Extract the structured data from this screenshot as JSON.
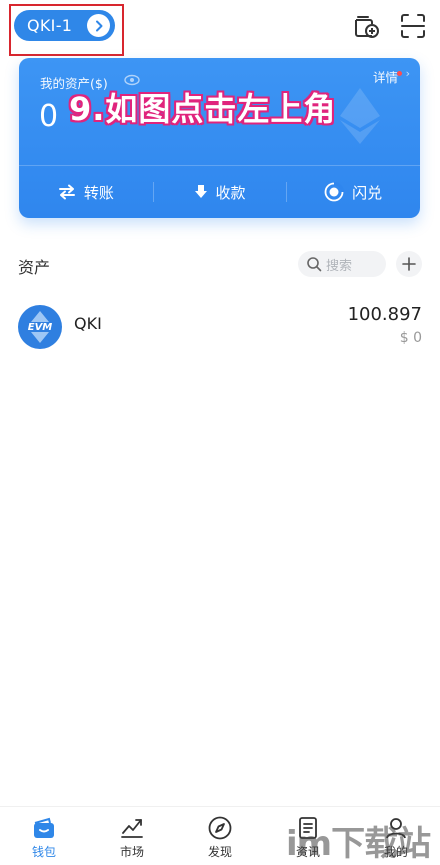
{
  "header": {
    "wallet_name": "QKI-1",
    "icons": [
      "chevron-right-icon",
      "add-wallet-icon",
      "scan-icon"
    ]
  },
  "asset_card": {
    "label": "我的资产($)",
    "amount": "0",
    "detail_label": "详情",
    "actions": [
      {
        "label": "转账",
        "icon": "transfer-icon"
      },
      {
        "label": "收款",
        "icon": "receive-icon"
      },
      {
        "label": "闪兑",
        "icon": "swap-icon"
      }
    ]
  },
  "annotation": {
    "text": "9.如图点击左上角"
  },
  "assets": {
    "title": "资产",
    "search_placeholder": "搜索",
    "tokens": [
      {
        "logo": "EVM",
        "name": "QKI",
        "amount": "100.897",
        "value": "$ 0"
      }
    ]
  },
  "bottom_nav": {
    "items": [
      {
        "label": "钱包",
        "icon": "wallet-icon",
        "active": true
      },
      {
        "label": "市场",
        "icon": "market-icon",
        "active": false
      },
      {
        "label": "发现",
        "icon": "compass-icon",
        "active": false
      },
      {
        "label": "资讯",
        "icon": "news-icon",
        "active": false
      },
      {
        "label": "我的",
        "icon": "profile-icon",
        "active": false
      }
    ]
  },
  "watermark": "im下载站",
  "colors": {
    "primary": "#2f87e8",
    "highlight_border": "#d8262e",
    "annotation_outline": "#e0247d"
  }
}
